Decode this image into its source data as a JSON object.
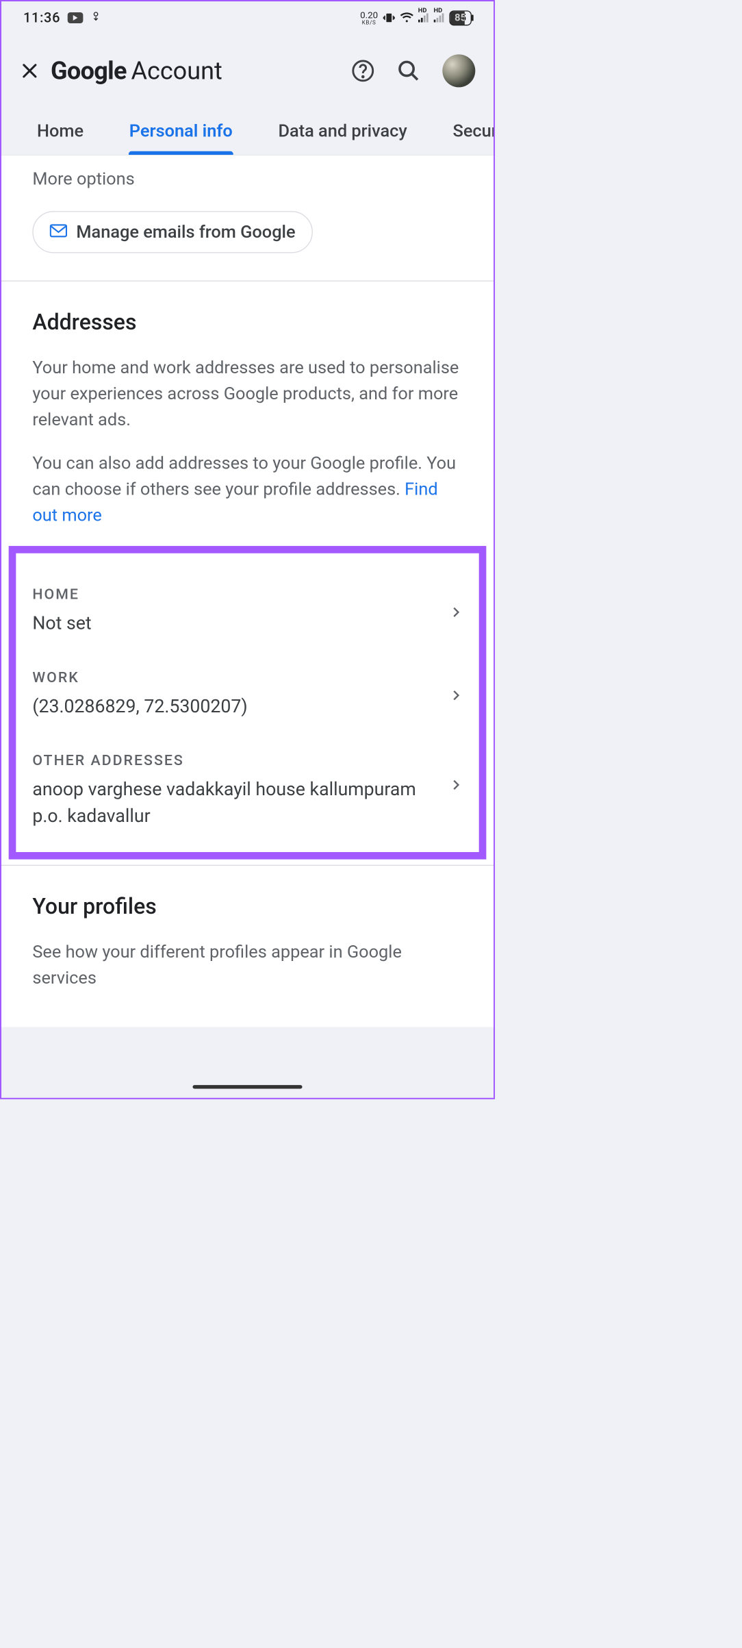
{
  "statusbar": {
    "time": "11:36",
    "netspeed_value": "0.20",
    "netspeed_unit": "KB/S",
    "sim_label": "HD",
    "battery": "85"
  },
  "header": {
    "brand_bold": "Google",
    "brand_rest": "Account"
  },
  "tabs": [
    {
      "label": "Home",
      "active": false
    },
    {
      "label": "Personal info",
      "active": true
    },
    {
      "label": "Data and privacy",
      "active": false
    },
    {
      "label": "Security",
      "active": false
    }
  ],
  "more_options": {
    "title": "More options",
    "button": "Manage emails from Google"
  },
  "addresses": {
    "title": "Addresses",
    "desc1": "Your home and work addresses are used to personalise your experiences across Google products, and for more relevant ads.",
    "desc2": "You can also add addresses to your Google profile. You can choose if others see your profile addresses. ",
    "link": "Find out more",
    "items": [
      {
        "label": "HOME",
        "value": "Not set"
      },
      {
        "label": "WORK",
        "value": "(23.0286829, 72.5300207)"
      },
      {
        "label": "OTHER ADDRESSES",
        "value": "anoop varghese vadakkayil house kallumpuram p.o. kadavallur"
      }
    ]
  },
  "profiles": {
    "title": "Your profiles",
    "desc": "See how your different profiles appear in Google services"
  }
}
